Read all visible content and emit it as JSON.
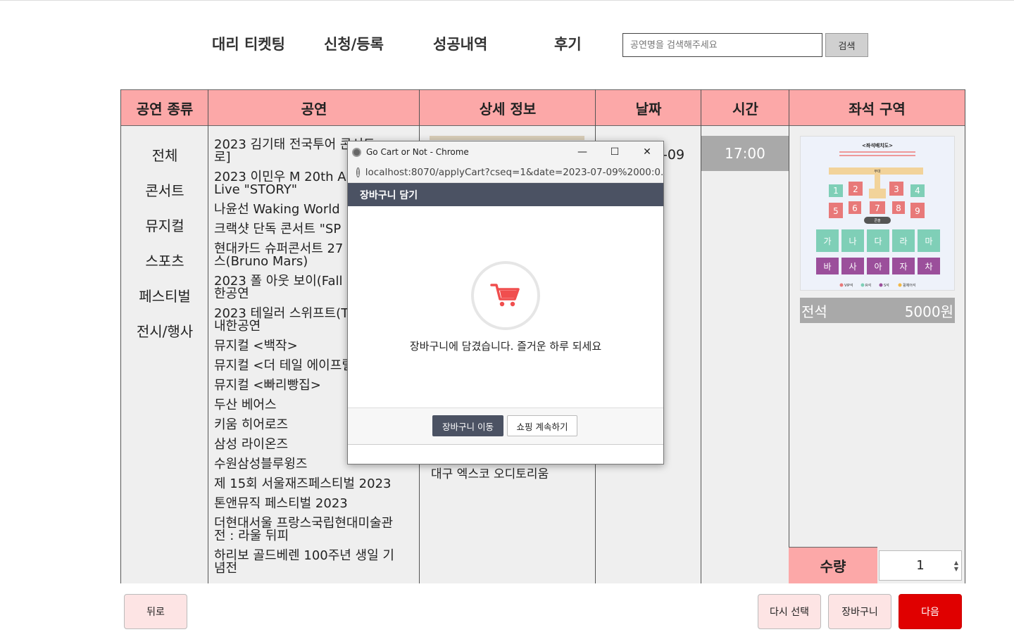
{
  "nav": {
    "items": [
      {
        "label": "대리 티켓팅"
      },
      {
        "label": "신청/등록"
      },
      {
        "label": "성공내역"
      },
      {
        "label": "후기"
      }
    ],
    "search_placeholder": "공연명을 검색해주세요",
    "search_button": "검색"
  },
  "table": {
    "headers": [
      "공연 종류",
      "공연",
      "상세 정보",
      "날짜",
      "시간",
      "좌석 구역"
    ],
    "genres": [
      "전체",
      "콘서트",
      "뮤지컬",
      "스포츠",
      "페스티벌",
      "전시/행사"
    ],
    "performances": [
      "2023 김기태 전국투어 콘서트",
      "로]",
      "2023 이민우 M 20th Anniversary",
      "Live \"STORY\"",
      "나윤선 Waking World",
      "크랙샷 단독 콘서트 \"SP",
      "현대카드 슈퍼콘서트 27",
      "스(Bruno Mars)",
      "2023 폴 아웃 보이(Fall Out Boy)",
      "한공연",
      "2023 테일러 스위프트(T",
      "내한공연",
      "뮤지컬 <백작>",
      "뮤지컬 <더 테일 에이프릴",
      "뮤지컬 <빠리빵집>",
      "두산 베어스",
      "키움 히어로즈",
      "삼성 라이온즈",
      "수원삼성블루윙즈",
      "제 15회 서울재즈페스티벌 2023",
      "톤앤뮤직 페스티벌 2023",
      "더현대서울 프랑스국립현대미술관",
      "전 : 라울 뒤피",
      "하리보 골드베렌 100주년 생일 기",
      "념전"
    ],
    "venue": "대구 엑스코 오디토리움",
    "date": "-09",
    "time": "17:00",
    "seat": {
      "map_title": "<좌석배치도>",
      "stage_label": "무대",
      "console_label": "콘솔",
      "blocks_numbers": [
        "1",
        "2",
        "3",
        "4",
        "5",
        "6",
        "7",
        "8",
        "9"
      ],
      "blocks_row1": [
        "가",
        "나",
        "다",
        "라",
        "마"
      ],
      "blocks_row2": [
        "바",
        "사",
        "아",
        "자",
        "차"
      ],
      "legend": [
        "VIP석",
        "R석",
        "S석",
        "휠체어석"
      ],
      "grade": "전석",
      "price": "5000원"
    },
    "quantity_label": "수량",
    "quantity_value": "1"
  },
  "buttons": {
    "back": "뒤로",
    "reselect": "다시 선택",
    "cart": "장바구니",
    "next": "다음"
  },
  "popup": {
    "window_title": "Go Cart or Not - Chrome",
    "url": "localhost:8070/applyCart?cseq=1&date=2023-07-09%2000:0...",
    "modal_title": "장바구니 담기",
    "message": "장바구니에 담겼습니다. 즐거운 하루 되세요",
    "go_cart": "장바구니 이동",
    "continue": "쇼핑 계속하기"
  },
  "colors": {
    "header_pink": "#fca8a8",
    "next_red": "#e00000",
    "modal_dark": "#4b5263",
    "cart_icon": "#f04e4e"
  }
}
